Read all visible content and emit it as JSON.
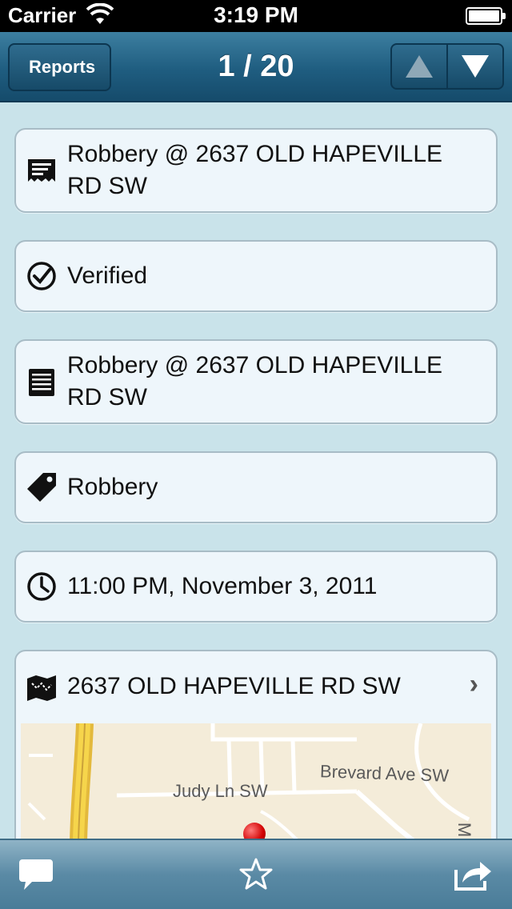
{
  "status_bar": {
    "carrier": "Carrier",
    "time": "3:19 PM"
  },
  "nav": {
    "back_label": "Reports",
    "title": "1 / 20",
    "prev_icon": "arrow-up-icon",
    "next_icon": "arrow-down-icon"
  },
  "cells": {
    "title": {
      "icon": "receipt-icon",
      "text": "Robbery @ 2637 OLD HAPEVILLE RD SW"
    },
    "status": {
      "icon": "check-circle-icon",
      "text": "Verified"
    },
    "description": {
      "icon": "notepad-icon",
      "text": "Robbery @ 2637 OLD HAPEVILLE RD SW"
    },
    "category": {
      "icon": "tag-icon",
      "text": "Robbery"
    },
    "date": {
      "icon": "clock-icon",
      "text": "11:00 PM, November 3, 2011"
    },
    "location": {
      "icon": "map-icon",
      "text": "2637 OLD HAPEVILLE RD SW"
    }
  },
  "map": {
    "labels": {
      "street1": "Brevard Ave SW",
      "street2": "Judy Ln SW",
      "street3": "M"
    }
  },
  "toolbar": {
    "comment_icon": "comment-icon",
    "favorite_icon": "star-icon",
    "share_icon": "share-icon"
  }
}
